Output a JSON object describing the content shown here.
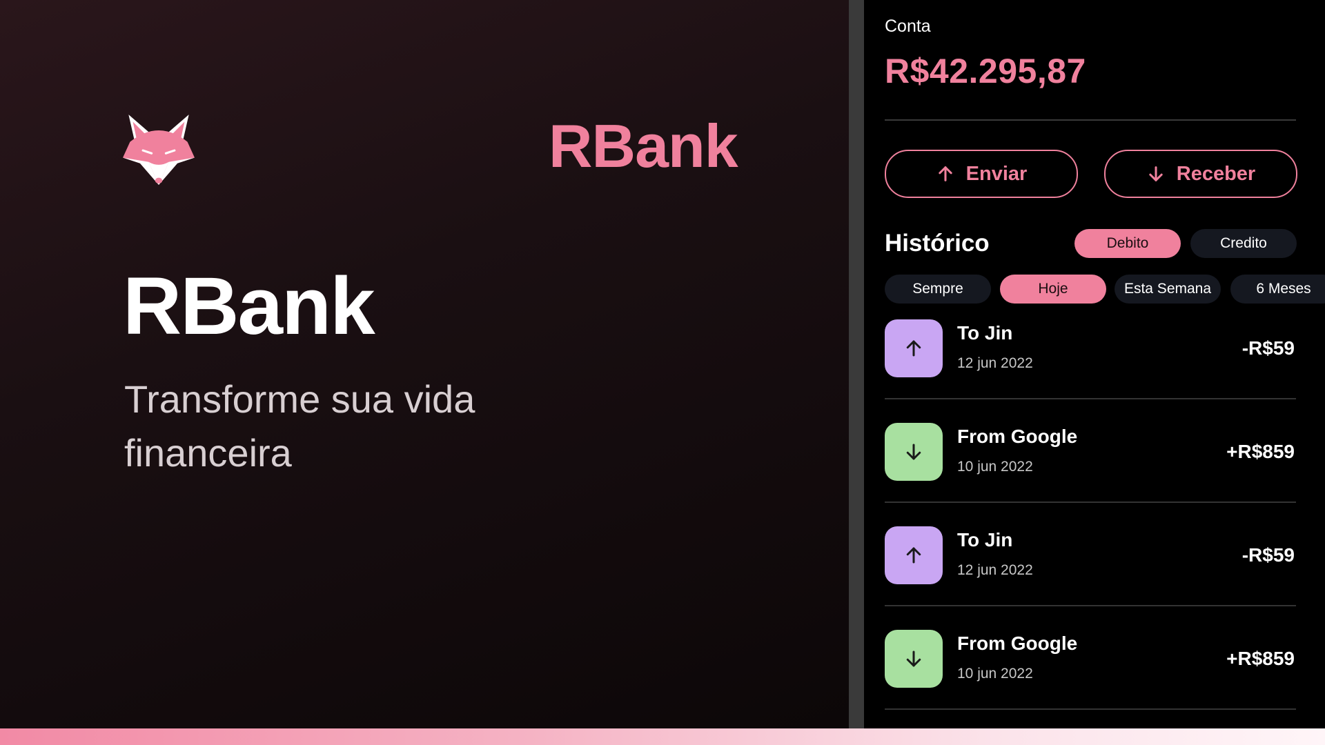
{
  "hero": {
    "brand_top": "RBank",
    "title": "RBank",
    "subtitle": "Transforme sua vida financeira",
    "logo_icon": "fox-logo-icon"
  },
  "account": {
    "label": "Conta",
    "balance": "R$42.295,87"
  },
  "actions": {
    "send_label": "Enviar",
    "send_icon": "arrow-up-icon",
    "receive_label": "Receber",
    "receive_icon": "arrow-down-icon"
  },
  "history": {
    "title": "Histórico",
    "type_filters": [
      {
        "label": "Debito",
        "active": true
      },
      {
        "label": "Credito",
        "active": false
      }
    ],
    "period_filters": [
      {
        "label": "Sempre",
        "active": false
      },
      {
        "label": "Hoje",
        "active": true
      },
      {
        "label": "Esta Semana",
        "active": false
      },
      {
        "label": "6 Meses",
        "active": false
      }
    ],
    "transactions": [
      {
        "name": "To Jin",
        "date": "12 jun 2022",
        "amount": "-R$59",
        "direction": "out"
      },
      {
        "name": "From Google",
        "date": "10 jun 2022",
        "amount": "+R$859",
        "direction": "in"
      },
      {
        "name": "To Jin",
        "date": "12 jun 2022",
        "amount": "-R$59",
        "direction": "out"
      },
      {
        "name": "From Google",
        "date": "10 jun 2022",
        "amount": "+R$859",
        "direction": "in"
      }
    ]
  },
  "colors": {
    "accent": "#f0819d",
    "out_icon_bg": "#c9a6f3",
    "in_icon_bg": "#a8e0a0",
    "panel_bg": "#000000"
  }
}
